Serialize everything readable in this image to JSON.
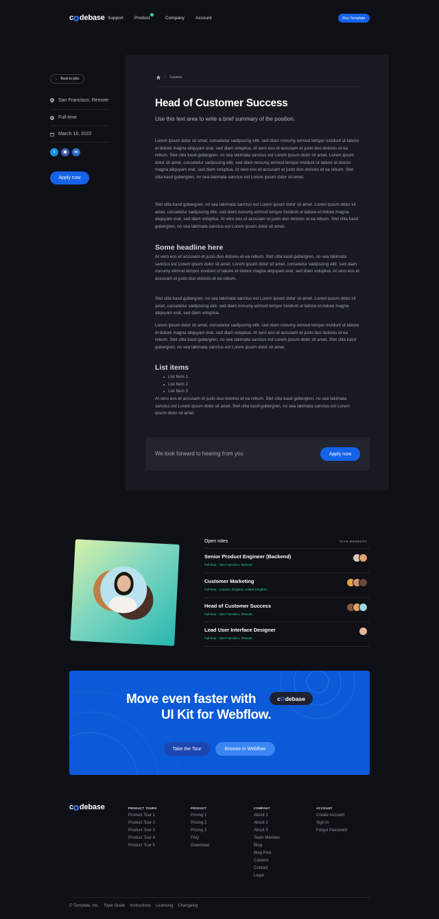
{
  "brand": {
    "pre": "c",
    "post": "debase"
  },
  "nav": {
    "links": [
      "Support",
      "Product",
      "Company",
      "Account"
    ],
    "buy_label": "Buy Template"
  },
  "sidebar": {
    "back_label": "Back to jobs",
    "location": "San Francisco, Remote",
    "type": "Full-time",
    "date": "March 16, 2022",
    "social": [
      "twitter-icon",
      "instagram-icon",
      "linkedin-icon"
    ],
    "apply_label": "Apply now"
  },
  "article": {
    "breadcrumb": [
      "Careers"
    ],
    "title": "Head of Customer Success",
    "summary": "Use this text area to write a brief summary of the position.",
    "p1": "Lorem ipsum dolor sit amet, consetetur sadipscing elitr, sed diam nonumy eirmod tempor invidunt ut labore et dolore magna aliquyam erat, sed diam voluptua. At vero eos et accusam et justo duo dolores et ea rebum. Stet clita kasd gubergren, no sea takimata sanctus est Lorem ipsum dolor sit amet. Lorem ipsum dolor sit amet, consetetur sadipscing elitr, sed diam nonumy eirmod tempor invidunt ut labore et dolore magna aliquyam erat, sed diam voluptua. At vero eos et accusam et justo duo dolores et ea rebum. Stet clita kasd gubergren, no sea takimata sanctus est Lorem ipsum dolor sit amet.",
    "p2": "Stet clita kasd gubergren, no sea takimata sanctus est Lorem ipsum dolor sit amet. Lorem ipsum dolor sit amet, consetetur sadipscing elitr, sed diam nonumy eirmod tempor invidunt ut labore et dolore magna aliquyam erat, sed diam voluptua. At vero eos et accusam et justo duo dolores et ea rebum. Stet clita kasd gubergren, no sea takimata sanctus est Lorem ipsum dolor sit amet.",
    "h2a": "Some headline here",
    "p3": "At vero eos et accusam et justo duo dolores et ea rebum. Stet clita kasd gubergren, no sea takimata sanctus est Lorem ipsum dolor sit amet. Lorem ipsum dolor sit amet, consetetur sadipscing elitr, sed diam nonumy eirmod tempor invidunt ut labore et dolore magna aliquyam erat, sed diam voluptua. At vero eos et accusam et justo duo dolores et ea rebum.",
    "p4": "Stet clita kasd gubergren, no sea takimata sanctus est Lorem ipsum dolor sit amet. Lorem ipsum dolor sit amet, consetetur sadipscing elitr, sed diam nonumy eirmod tempor invidunt ut labore et dolore magna aliquyam erat, sed diam voluptua.",
    "p5": "Lorem ipsum dolor sit amet, consetetur sadipscing elitr, sed diam nonumy eirmod tempor invidunt ut labore et dolore magna aliquyam erat, sed diam voluptua. At vero eos et accusam et justo duo dolores et ea rebum. Stet clita kasd gubergren, no sea takimata sanctus est Lorem ipsum dolor sit amet. Stet clita kasd gubergren, no sea takimata sanctus est Lorem ipsum dolor sit amet.",
    "h2b": "List items",
    "list": [
      "List Item 1",
      "List Item 2",
      "List Item 3"
    ],
    "p6": "At vero eos et accusam et justo duo dolores et ea rebum. Stet clita kasd gubergren, no sea takimata sanctus est Lorem ipsum dolor sit amet. Stet clita kasd gubergren, no sea takimata sanctus est Lorem ipsum dolor sit amet.",
    "cta_text": "We look forward to hearing from you",
    "cta_button": "Apply now"
  },
  "roles": {
    "heading": "Open roles",
    "team_label": "TEAM MEMBERS",
    "items": [
      {
        "title": "Senior Product Engineer (Backend)",
        "type": "Full-time",
        "location": "San Francisco, Remote"
      },
      {
        "title": "Customer Marketing",
        "type": "Full-time",
        "location": "London, England, United Kingdom"
      },
      {
        "title": "Head of Customer Success",
        "type": "Full-time",
        "location": "San Francisco, Remote"
      },
      {
        "title": "Lead User Interface Designer",
        "type": "Full-time",
        "location": "San Francisco, Remote"
      }
    ]
  },
  "banner": {
    "line1": "Move even faster with",
    "line2": "UI Kit for Webflow.",
    "pill_pre": "c",
    "pill_post": "debase",
    "tour_label": "Take the Tour",
    "browse_label": "Browse in Webflow"
  },
  "footer": {
    "columns": [
      {
        "head": "PRODUCT TOURS",
        "links": [
          "Product Tour 1",
          "Product Tour 2",
          "Product Tour 3",
          "Product Tour 4",
          "Product Tour 5"
        ]
      },
      {
        "head": "PRODUCT",
        "links": [
          "Pricing 1",
          "Pricing 2",
          "Pricing 3",
          "FAQ",
          "Download"
        ]
      },
      {
        "head": "COMPANY",
        "links": [
          "About 1",
          "About 2",
          "About 3",
          "Team Member",
          "Blog",
          "Blog Post",
          "Careers",
          "Contact",
          "Legal"
        ]
      },
      {
        "head": "ACCOUNT",
        "links": [
          "Create Account",
          "Sign In",
          "Forgot Password"
        ]
      }
    ],
    "bottom": [
      "© Template, Inc.",
      "Style Guide",
      "Instructions",
      "Licensing",
      "Changelog"
    ]
  },
  "colors": {
    "accent": "#1462e8",
    "background": "#0e1016",
    "card": "#171a21",
    "green": "#2fd4a0"
  }
}
